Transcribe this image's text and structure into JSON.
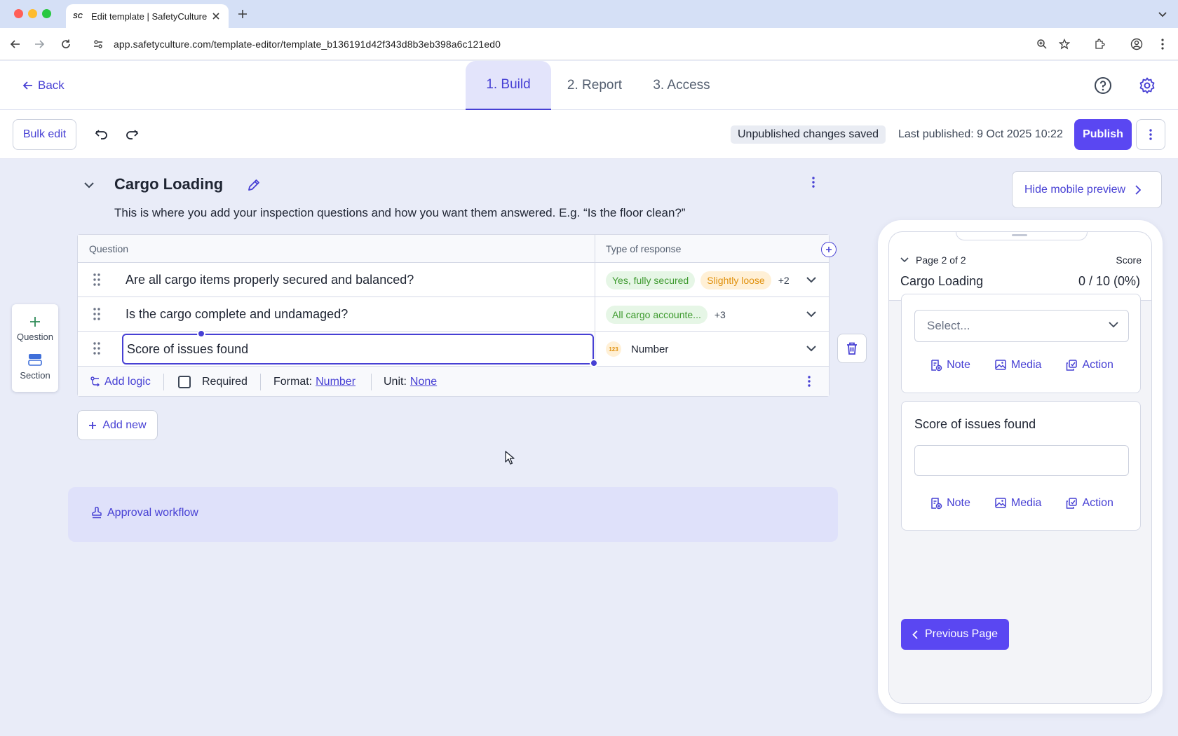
{
  "browser": {
    "tab_title": "Edit template | SafetyCulture",
    "favicon_text": "SC",
    "url": "app.safetyculture.com/template-editor/template_b136191d42f343d8b3eb398a6c121ed0"
  },
  "header": {
    "back_label": "Back",
    "tabs": [
      {
        "label": "1. Build",
        "active": true
      },
      {
        "label": "2. Report",
        "active": false
      },
      {
        "label": "3. Access",
        "active": false
      }
    ],
    "help_icon": "help-circle-icon",
    "settings_icon": "gear-icon"
  },
  "toolbar": {
    "bulk_edit_label": "Bulk edit",
    "status_text": "Unpublished changes saved",
    "last_published": "Last published: 9 Oct 2025 10:22",
    "publish_label": "Publish"
  },
  "section": {
    "title": "Cargo Loading",
    "description": "This is where you add your inspection questions and how you want them answered. E.g. “Is the floor clean?”"
  },
  "table": {
    "col_question": "Question",
    "col_response": "Type of response",
    "rows": [
      {
        "question": "Are all cargo items properly secured and balanced?",
        "chips": [
          "Yes, fully secured",
          "Slightly loose"
        ],
        "more": "+2"
      },
      {
        "question": "Is the cargo complete and undamaged?",
        "chips": [
          "All cargo accounte..."
        ],
        "more": "+3"
      },
      {
        "question": "Score of issues found",
        "response_badge": "123",
        "response_label": "Number"
      }
    ],
    "footer": {
      "add_logic": "Add logic",
      "required": "Required",
      "format_label": "Format:",
      "format_value": "Number",
      "unit_label": "Unit:",
      "unit_value": "None"
    }
  },
  "palette": {
    "question_label": "Question",
    "section_label": "Section"
  },
  "add_new_label": "Add new",
  "approval_label": "Approval workflow",
  "preview": {
    "hide_label": "Hide mobile preview",
    "page_indicator": "Page 2 of 2",
    "score_label": "Score",
    "title": "Cargo Loading",
    "score_value": "0 / 10 (0%)",
    "select_placeholder": "Select...",
    "question": "Score of issues found",
    "note_label": "Note",
    "media_label": "Media",
    "action_label": "Action",
    "prev_page_label": "Previous Page"
  },
  "colors": {
    "accent": "#4740d4",
    "primary_button": "#5a47f2",
    "chip_green": "#3d9a2e",
    "chip_orange": "#e0900c"
  }
}
